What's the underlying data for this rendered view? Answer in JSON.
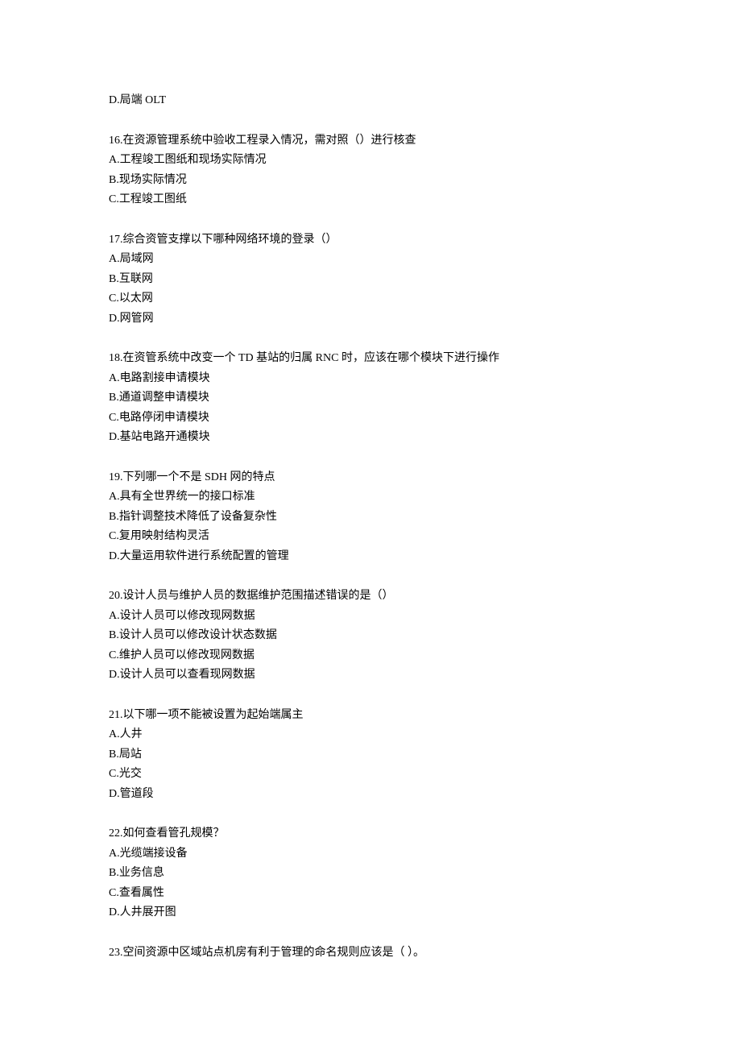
{
  "orphan": {
    "text": "D.局端 OLT"
  },
  "questions": [
    {
      "id": "q16",
      "stem": "16.在资源管理系统中验收工程录入情况，需对照（）进行核查",
      "options": [
        "A.工程竣工图纸和现场实际情况",
        "B.现场实际情况",
        "C.工程竣工图纸"
      ]
    },
    {
      "id": "q17",
      "stem": "17.综合资管支撑以下哪种网络环境的登录（）",
      "options": [
        "A.局域网",
        "B.互联网",
        "C.以太网",
        "D.网管网"
      ]
    },
    {
      "id": "q18",
      "stem": "18.在资管系统中改变一个 TD 基站的归属 RNC 时，应该在哪个模块下进行操作",
      "options": [
        "A.电路割接申请模块",
        "B.通道调整申请模块",
        "C.电路停闭申请模块",
        "D.基站电路开通模块"
      ]
    },
    {
      "id": "q19",
      "stem": "19.下列哪一个不是 SDH 网的特点",
      "options": [
        "A.具有全世界统一的接口标准",
        "B.指针调整技术降低了设备复杂性",
        "C.复用映射结构灵活",
        "D.大量运用软件进行系统配置的管理"
      ]
    },
    {
      "id": "q20",
      "stem": "20.设计人员与维护人员的数据维护范围描述错误的是（）",
      "options": [
        "A.设计人员可以修改现网数据",
        "B.设计人员可以修改设计状态数据",
        "C.维护人员可以修改现网数据",
        "D.设计人员可以查看现网数据"
      ]
    },
    {
      "id": "q21",
      "stem": "21.以下哪一项不能被设置为起始端属主",
      "options": [
        "A.人井",
        "B.局站",
        "C.光交",
        "D.管道段"
      ]
    },
    {
      "id": "q22",
      "stem": "22.如何查看管孔规模？",
      "options": [
        "A.光缆端接设备",
        "B.业务信息",
        "C.查看属性",
        "D.人井展开图"
      ]
    },
    {
      "id": "q23",
      "stem": "23.空间资源中区域站点机房有利于管理的命名规则应该是（ ）。",
      "options": []
    }
  ]
}
